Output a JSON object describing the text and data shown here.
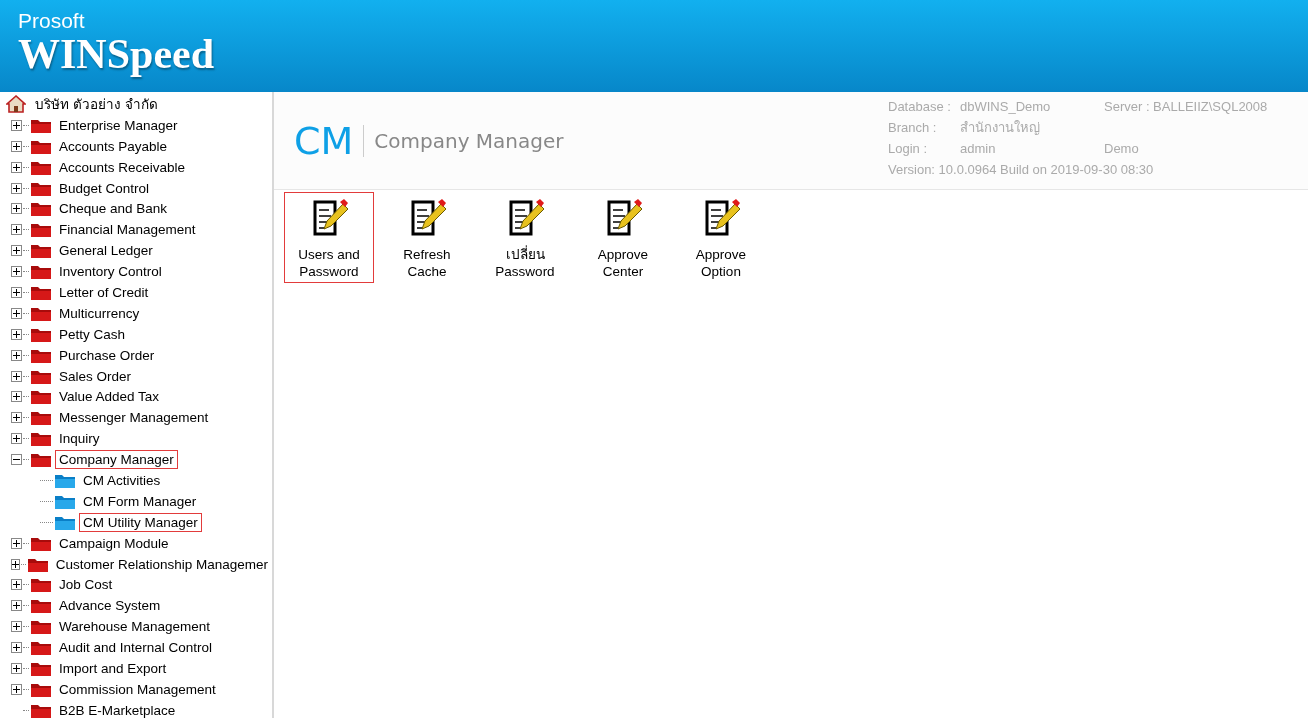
{
  "brand": {
    "small": "Prosoft",
    "large": "WINSpeed"
  },
  "tree": {
    "label": "บริษัท ตัวอย่าง จำกัด",
    "children": [
      {
        "label": "Enterprise Manager",
        "kind": "group",
        "expanded": false,
        "selected": false
      },
      {
        "label": "Accounts Payable",
        "kind": "group",
        "expanded": false,
        "selected": false
      },
      {
        "label": "Accounts Receivable",
        "kind": "group",
        "expanded": false,
        "selected": false
      },
      {
        "label": "Budget Control",
        "kind": "group",
        "expanded": false,
        "selected": false
      },
      {
        "label": "Cheque and Bank",
        "kind": "group",
        "expanded": false,
        "selected": false
      },
      {
        "label": "Financial Management",
        "kind": "group",
        "expanded": false,
        "selected": false
      },
      {
        "label": "General Ledger",
        "kind": "group",
        "expanded": false,
        "selected": false
      },
      {
        "label": "Inventory Control",
        "kind": "group",
        "expanded": false,
        "selected": false
      },
      {
        "label": "Letter of Credit",
        "kind": "group",
        "expanded": false,
        "selected": false
      },
      {
        "label": "Multicurrency",
        "kind": "group",
        "expanded": false,
        "selected": false
      },
      {
        "label": "Petty Cash",
        "kind": "group",
        "expanded": false,
        "selected": false
      },
      {
        "label": "Purchase Order",
        "kind": "group",
        "expanded": false,
        "selected": false
      },
      {
        "label": "Sales Order",
        "kind": "group",
        "expanded": false,
        "selected": false
      },
      {
        "label": "Value Added Tax",
        "kind": "group",
        "expanded": false,
        "selected": false
      },
      {
        "label": "Messenger Management",
        "kind": "group",
        "expanded": false,
        "selected": false
      },
      {
        "label": "Inquiry",
        "kind": "group",
        "expanded": false,
        "selected": false
      },
      {
        "label": "Company Manager",
        "kind": "group",
        "expanded": true,
        "selected": true,
        "children": [
          {
            "label": "CM Activities",
            "selected": false
          },
          {
            "label": "CM Form Manager",
            "selected": false
          },
          {
            "label": "CM Utility Manager",
            "selected": true
          }
        ]
      },
      {
        "label": "Campaign Module",
        "kind": "group",
        "expanded": false,
        "selected": false
      },
      {
        "label": "Customer Relationship Managemer",
        "kind": "group",
        "expanded": false,
        "selected": false
      },
      {
        "label": "Job Cost",
        "kind": "group",
        "expanded": false,
        "selected": false
      },
      {
        "label": "Advance System",
        "kind": "group",
        "expanded": false,
        "selected": false
      },
      {
        "label": "Warehouse Management",
        "kind": "group",
        "expanded": false,
        "selected": false
      },
      {
        "label": "Audit and Internal Control",
        "kind": "group",
        "expanded": false,
        "selected": false
      },
      {
        "label": "Import and Export",
        "kind": "group",
        "expanded": false,
        "selected": false
      },
      {
        "label": "Commission Management",
        "kind": "group",
        "expanded": false,
        "selected": false
      },
      {
        "label": "B2B E-Marketplace",
        "kind": "leaf",
        "selected": false
      }
    ]
  },
  "module": {
    "code": "CM",
    "title": "Company Manager"
  },
  "info": {
    "rows": [
      {
        "label": "Database :",
        "value": "dbWINS_Demo",
        "extra": "Server : BALLEIIZ\\SQL2008"
      },
      {
        "label": "Branch :",
        "value": "สำนักงานใหญ่"
      },
      {
        "label": "Login :",
        "value": "admin",
        "extra": "Demo"
      }
    ],
    "version": "Version: 10.0.0964  Build on 2019-09-30 08:30"
  },
  "tools": [
    {
      "label": "Users and Password",
      "selected": true
    },
    {
      "label": "Refresh Cache",
      "selected": false
    },
    {
      "label": "เปลี่ยน Password",
      "selected": false
    },
    {
      "label": "Approve Center",
      "selected": false
    },
    {
      "label": "Approve Option",
      "selected": false
    }
  ]
}
